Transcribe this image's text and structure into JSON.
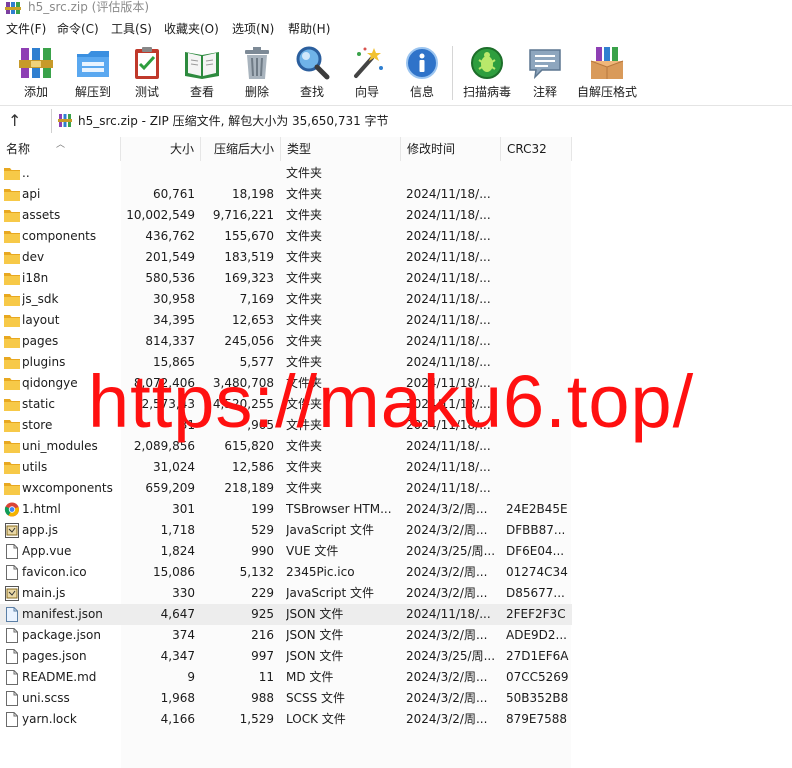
{
  "window": {
    "title": "h5_src.zip (评估版本)"
  },
  "menu": [
    "文件(F)",
    "命令(C)",
    "工具(S)",
    "收藏夹(O)",
    "选项(N)",
    "帮助(H)"
  ],
  "toolbar": [
    {
      "label": "添加",
      "icon": "add-archive-icon"
    },
    {
      "label": "解压到",
      "icon": "extract-to-folder-icon"
    },
    {
      "label": "测试",
      "icon": "test-clipboard-icon"
    },
    {
      "label": "查看",
      "icon": "view-book-icon"
    },
    {
      "label": "删除",
      "icon": "trash-icon"
    },
    {
      "label": "查找",
      "icon": "magnifier-icon"
    },
    {
      "label": "向导",
      "icon": "wizard-wand-icon"
    },
    {
      "label": "信息",
      "icon": "info-icon"
    },
    {
      "label": "扫描病毒",
      "icon": "virus-scan-icon"
    },
    {
      "label": "注释",
      "icon": "comment-icon"
    },
    {
      "label": "自解压格式",
      "icon": "sfx-box-icon"
    }
  ],
  "pathbar": {
    "up": "↑",
    "path": "h5_src.zip - ZIP 压缩文件, 解包大小为 35,650,731 字节"
  },
  "columns": {
    "name": "名称",
    "size": "大小",
    "packed": "压缩后大小",
    "type": "类型",
    "modified": "修改时间",
    "crc": "CRC32"
  },
  "files": [
    {
      "name": "..",
      "size": "",
      "packed": "",
      "type": "文件夹",
      "modified": "",
      "crc": "",
      "icon": "folder-icon"
    },
    {
      "name": "api",
      "size": "60,761",
      "packed": "18,198",
      "type": "文件夹",
      "modified": "2024/11/18/...",
      "crc": "",
      "icon": "folder-icon"
    },
    {
      "name": "assets",
      "size": "10,002,549",
      "packed": "9,716,221",
      "type": "文件夹",
      "modified": "2024/11/18/...",
      "crc": "",
      "icon": "folder-icon"
    },
    {
      "name": "components",
      "size": "436,762",
      "packed": "155,670",
      "type": "文件夹",
      "modified": "2024/11/18/...",
      "crc": "",
      "icon": "folder-icon"
    },
    {
      "name": "dev",
      "size": "201,549",
      "packed": "183,519",
      "type": "文件夹",
      "modified": "2024/11/18/...",
      "crc": "",
      "icon": "folder-icon"
    },
    {
      "name": "i18n",
      "size": "580,536",
      "packed": "169,323",
      "type": "文件夹",
      "modified": "2024/11/18/...",
      "crc": "",
      "icon": "folder-icon"
    },
    {
      "name": "js_sdk",
      "size": "30,958",
      "packed": "7,169",
      "type": "文件夹",
      "modified": "2024/11/18/...",
      "crc": "",
      "icon": "folder-icon"
    },
    {
      "name": "layout",
      "size": "34,395",
      "packed": "12,653",
      "type": "文件夹",
      "modified": "2024/11/18/...",
      "crc": "",
      "icon": "folder-icon"
    },
    {
      "name": "pages",
      "size": "814,337",
      "packed": "245,056",
      "type": "文件夹",
      "modified": "2024/11/18/...",
      "crc": "",
      "icon": "folder-icon"
    },
    {
      "name": "plugins",
      "size": "15,865",
      "packed": "5,577",
      "type": "文件夹",
      "modified": "2024/11/18/...",
      "crc": "",
      "icon": "folder-icon"
    },
    {
      "name": "qidongye",
      "size": "8,072,406",
      "packed": "3,480,708",
      "type": "文件夹",
      "modified": "2024/11/18/...",
      "crc": "",
      "icon": "folder-icon"
    },
    {
      "name": "static",
      "size": "2,573,43",
      "packed": "4,520,255",
      "type": "文件夹",
      "modified": "2024/11/18/...",
      "crc": "",
      "icon": "folder-icon"
    },
    {
      "name": "store",
      "size": "31",
      "packed": ",905",
      "type": "文件夹",
      "modified": "2024/11/18/...",
      "crc": "",
      "icon": "folder-icon"
    },
    {
      "name": "uni_modules",
      "size": "2,089,856",
      "packed": "615,820",
      "type": "文件夹",
      "modified": "2024/11/18/...",
      "crc": "",
      "icon": "folder-icon"
    },
    {
      "name": "utils",
      "size": "31,024",
      "packed": "12,586",
      "type": "文件夹",
      "modified": "2024/11/18/...",
      "crc": "",
      "icon": "folder-icon"
    },
    {
      "name": "wxcomponents",
      "size": "659,209",
      "packed": "218,189",
      "type": "文件夹",
      "modified": "2024/11/18/...",
      "crc": "",
      "icon": "folder-icon"
    },
    {
      "name": "1.html",
      "size": "301",
      "packed": "199",
      "type": "TSBrowser HTM...",
      "modified": "2024/3/2/周...",
      "crc": "24E2B45E",
      "icon": "chrome-html-icon"
    },
    {
      "name": "app.js",
      "size": "1,718",
      "packed": "529",
      "type": "JavaScript 文件",
      "modified": "2024/3/2/周...",
      "crc": "DFBB87...",
      "icon": "script-file-icon"
    },
    {
      "name": "App.vue",
      "size": "1,824",
      "packed": "990",
      "type": "VUE 文件",
      "modified": "2024/3/25/周...",
      "crc": "DF6E04...",
      "icon": "blank-file-icon"
    },
    {
      "name": "favicon.ico",
      "size": "15,086",
      "packed": "5,132",
      "type": "2345Pic.ico",
      "modified": "2024/3/2/周...",
      "crc": "01274C34",
      "icon": "blank-file-icon"
    },
    {
      "name": "main.js",
      "size": "330",
      "packed": "229",
      "type": "JavaScript 文件",
      "modified": "2024/3/2/周...",
      "crc": "D85677...",
      "icon": "script-file-icon"
    },
    {
      "name": "manifest.json",
      "size": "4,647",
      "packed": "925",
      "type": "JSON 文件",
      "modified": "2024/11/18/...",
      "crc": "2FEF2F3C",
      "icon": "json-file-icon",
      "selected": true
    },
    {
      "name": "package.json",
      "size": "374",
      "packed": "216",
      "type": "JSON 文件",
      "modified": "2024/3/2/周...",
      "crc": "ADE9D2...",
      "icon": "blank-file-icon"
    },
    {
      "name": "pages.json",
      "size": "4,347",
      "packed": "997",
      "type": "JSON 文件",
      "modified": "2024/3/25/周...",
      "crc": "27D1EF6A",
      "icon": "blank-file-icon"
    },
    {
      "name": "README.md",
      "size": "9",
      "packed": "11",
      "type": "MD 文件",
      "modified": "2024/3/2/周...",
      "crc": "07CC5269",
      "icon": "blank-file-icon"
    },
    {
      "name": "uni.scss",
      "size": "1,968",
      "packed": "988",
      "type": "SCSS 文件",
      "modified": "2024/3/2/周...",
      "crc": "50B352B8",
      "icon": "blank-file-icon"
    },
    {
      "name": "yarn.lock",
      "size": "4,166",
      "packed": "1,529",
      "type": "LOCK 文件",
      "modified": "2024/3/2/周...",
      "crc": "879E7588",
      "icon": "blank-file-icon"
    }
  ],
  "watermark": "https://maku6.top/",
  "colors": {
    "watermark": "#ff1010",
    "folder": "#f7c948",
    "selected_row": "#ededed"
  }
}
